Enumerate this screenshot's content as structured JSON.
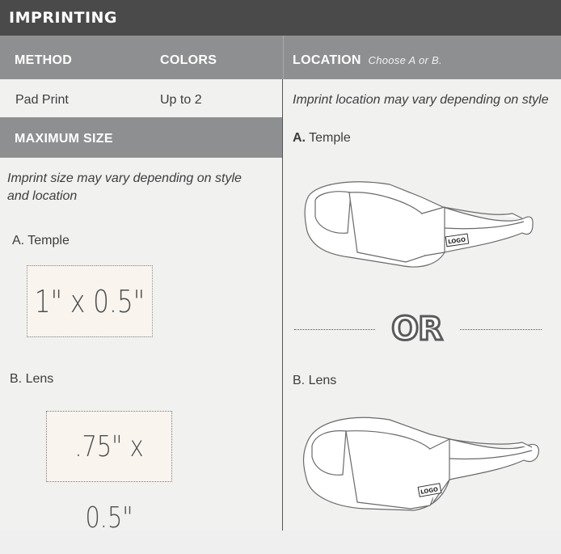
{
  "title": "IMPRINTING",
  "table_header": {
    "method": "METHOD",
    "colors": "COLORS",
    "location": "LOCATION",
    "location_hint": "Choose A or B."
  },
  "row": {
    "method": "Pad Print",
    "colors": "Up to 2",
    "location_note": "Imprint location may vary depending on style"
  },
  "max_size": {
    "header": "MAXIMUM SIZE",
    "note_line1": "Imprint size may vary depending on style",
    "note_line2": "and location",
    "a_label": "A. Temple",
    "a_size": "1\" x 0.5\"",
    "b_label": "B. Lens",
    "b_size": ".75\" x 0.5\""
  },
  "locations": {
    "a_prefix": "A.",
    "a_name": "Temple",
    "or_text": "OR",
    "b_label": "B. Lens",
    "logo_text": "LOGO"
  }
}
